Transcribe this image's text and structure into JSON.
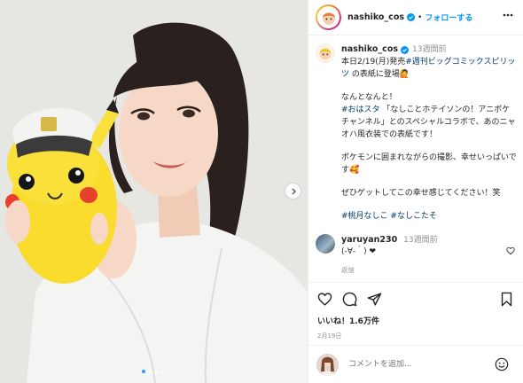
{
  "post": {
    "username": "nashiko_cos",
    "separator": "•",
    "follow_label": "フォローする"
  },
  "caption": {
    "username": "nashiko_cos",
    "time_ago": "13週間前",
    "line1_prefix": "本日2/19(月)発売",
    "line1_link": "#週刊ビッグコミックスピリッツ",
    "line1_suffix": " の表紙に登場🙋",
    "para1_line1": "なんとなんと！",
    "para1_hashtag": "#おはスタ",
    "para1_text": " 「なしことホテイソンの！アニポケチャンネル」とのスペシャルコラボで、あのニャオハ風衣装での表紙です！",
    "para2": "ポケモンに囲まれながらの撮影、幸せいっぱいです🥰",
    "para3": "ぜひゲットしてこの幸せ感じてください！笑",
    "tags": "#桃月なしこ #なしこたそ"
  },
  "comment": {
    "username": "yaruyan230",
    "time_ago": "13週間前",
    "text": "(-∀-｀) ❤",
    "reply_label": "返信"
  },
  "stats": {
    "likes": "いいね！1.6万件",
    "date": "2月19日"
  },
  "add_comment": {
    "placeholder": "コメントを追加..."
  },
  "carousel": {
    "total_slides": 4,
    "current_slide": 1
  },
  "colors": {
    "accent": "#0095f6",
    "hashtag": "#00376b",
    "muted": "#8e8e8e",
    "carousel_active": "#2c9cf6"
  }
}
